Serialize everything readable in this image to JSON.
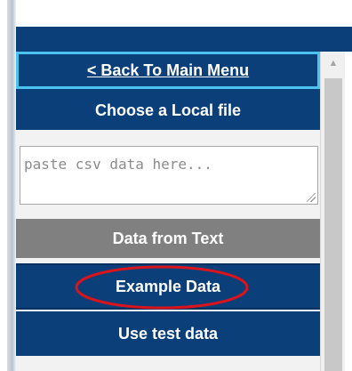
{
  "menu": {
    "back_label": "< Back To Main Menu",
    "local_file_label": "Choose a Local file",
    "csv_input": {
      "value": "",
      "placeholder": "paste csv data here..."
    },
    "data_from_text_label": "Data from Text",
    "example_data_label": "Example Data",
    "test_data_label": "Use test data"
  },
  "scrollbar": {
    "up_arrow_icon": "triangle-up-icon"
  },
  "annotation": {
    "highlight_color": "#d9141c",
    "highlighted_item": "Example Data"
  },
  "colors": {
    "button_primary": "#0b3f7a",
    "button_disabled": "#808080",
    "focus_border": "#4cc3ee",
    "panel_background": "#f2f2f2"
  }
}
